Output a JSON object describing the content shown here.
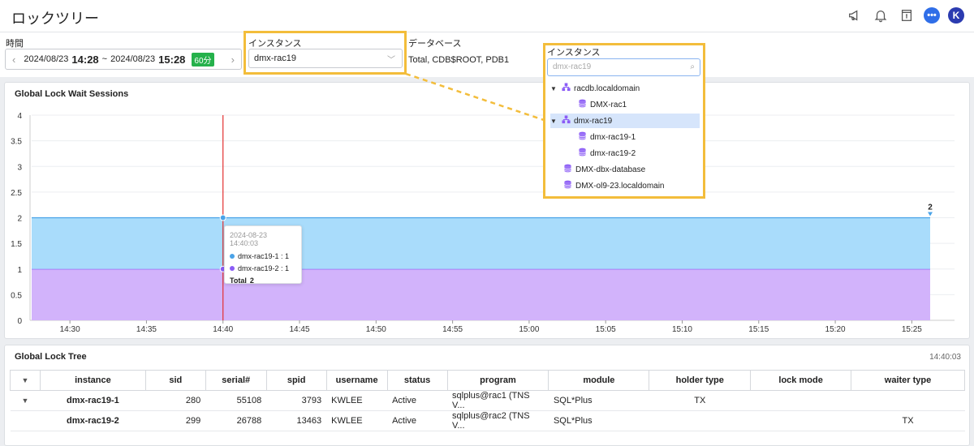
{
  "app": {
    "title": "ロックツリー"
  },
  "header_icons": [
    "megaphone-icon",
    "bell-icon",
    "document-icon",
    "chat-icon",
    "user-avatar"
  ],
  "user": {
    "initial": "K"
  },
  "filters": {
    "time_label": "時間",
    "date_from": "2024/08/23",
    "time_from": "14:28",
    "tilde": "~",
    "date_to": "2024/08/23",
    "time_to": "15:28",
    "duration": "60分",
    "instance_label": "インスタンス",
    "instance_value": "dmx-rac19",
    "database_label": "データベース",
    "database_value": "Total, CDB$ROOT, PDB1"
  },
  "dropdown": {
    "label": "インスタンス",
    "search_placeholder": "dmx-rac19",
    "items": [
      {
        "label": "racdb.localdomain",
        "level": 0,
        "type": "cluster",
        "expanded": true
      },
      {
        "label": "DMX-rac1",
        "level": 1,
        "type": "db"
      },
      {
        "label": "dmx-rac19",
        "level": 0,
        "type": "cluster",
        "expanded": true,
        "selected": true
      },
      {
        "label": "dmx-rac19-1",
        "level": 1,
        "type": "db"
      },
      {
        "label": "dmx-rac19-2",
        "level": 1,
        "type": "db"
      },
      {
        "label": "DMX-dbx-database",
        "level": 0,
        "type": "db"
      },
      {
        "label": "DMX-ol9-23.localdomain",
        "level": 0,
        "type": "db"
      }
    ]
  },
  "chart_panel": {
    "title": "Global Lock Wait Sessions"
  },
  "chart_data": {
    "type": "area",
    "stacked": true,
    "x": [
      "14:28",
      "15:26"
    ],
    "xticks": [
      "14:30",
      "14:35",
      "14:40",
      "14:45",
      "14:50",
      "14:55",
      "15:00",
      "15:05",
      "15:10",
      "15:15",
      "15:20",
      "15:25"
    ],
    "yticks": [
      "0",
      "0.5",
      "1",
      "1.5",
      "2",
      "2.5",
      "3",
      "3.5",
      "4"
    ],
    "ylim": [
      0,
      4
    ],
    "series": [
      {
        "name": "dmx-rac19-2",
        "values": [
          1,
          1
        ],
        "color": "#d2b3fb",
        "line": "#8b5cf6"
      },
      {
        "name": "dmx-rac19-1",
        "values": [
          1,
          1
        ],
        "color": "#a9dcfb",
        "line": "#4aa3e8"
      }
    ],
    "end_label": "2",
    "cursor_time": "14:40",
    "grid": true
  },
  "tooltip": {
    "time": "2024-08-23 14:40:03",
    "rows": [
      {
        "text": "dmx-rac19-1 : 1",
        "color": "#4aa3e8"
      },
      {
        "text": "dmx-rac19-2 : 1",
        "color": "#8b5cf6"
      }
    ],
    "total_label": "Total",
    "total_value": "2"
  },
  "tree_panel": {
    "title": "Global Lock Tree",
    "updated": "14:40:03",
    "columns": [
      "instance",
      "sid",
      "serial#",
      "spid",
      "username",
      "status",
      "program",
      "module",
      "holder type",
      "lock mode",
      "waiter type"
    ],
    "rows": [
      {
        "instance": "dmx-rac19-1",
        "sid": "280",
        "serial": "55108",
        "spid": "3793",
        "username": "KWLEE",
        "status": "Active",
        "program": "sqlplus@rac1 (TNS V...",
        "module": "SQL*Plus",
        "holder_type": "TX",
        "lock_mode": "",
        "waiter_type": ""
      },
      {
        "instance": "dmx-rac19-2",
        "sid": "299",
        "serial": "26788",
        "spid": "13463",
        "username": "KWLEE",
        "status": "Active",
        "program": "sqlplus@rac2 (TNS V...",
        "module": "SQL*Plus",
        "holder_type": "",
        "lock_mode": "",
        "waiter_type": "TX"
      }
    ]
  }
}
